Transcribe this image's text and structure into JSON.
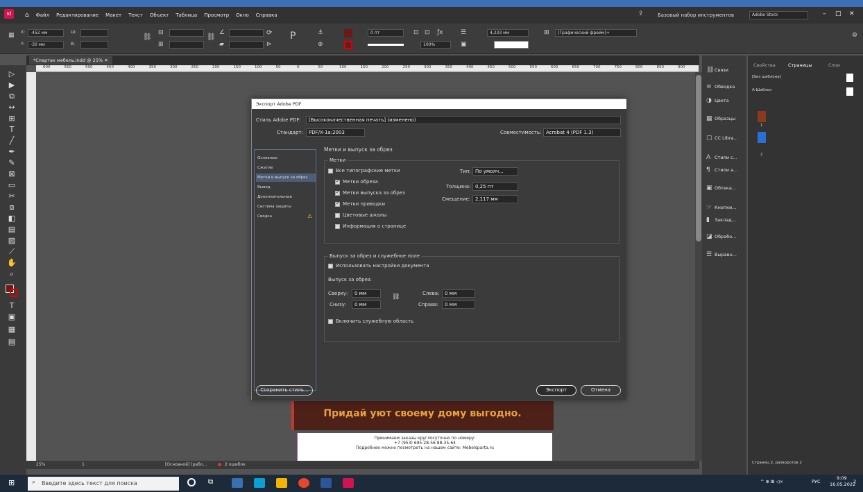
{
  "menubar": {
    "items": [
      "Файл",
      "Редактирование",
      "Макет",
      "Текст",
      "Объект",
      "Таблица",
      "Просмотр",
      "Окно",
      "Справка"
    ],
    "workspace": "Базовый набор инструментов",
    "search_placeholder": "Adobe Stock"
  },
  "controlbar": {
    "x": "-452 мм",
    "y": "-30 мм",
    "w_label": "Ш:",
    "h_label": "В:",
    "stroke": "0 пт",
    "size": "4,233 мм",
    "opacity": "100%",
    "frame_style": "[Графический фрейм]+"
  },
  "document": {
    "tab": "*Спартак мебель.indd @ 25%",
    "zoom": "25%",
    "page": "1",
    "style": "[Основной] (рабо...",
    "errors": "2 ошибок"
  },
  "ruler": [
    "600",
    "550",
    "500",
    "450",
    "400",
    "350",
    "300",
    "250",
    "200",
    "150",
    "100",
    "50",
    "0",
    "50",
    "100",
    "150",
    "200",
    "250",
    "300",
    "350",
    "400",
    "450",
    "500",
    "550",
    "600",
    "650",
    "700",
    "750",
    "800",
    "850",
    "900"
  ],
  "panels": {
    "icons": [
      "Связи",
      "Обводка",
      "Цвета",
      "Образцы",
      "CC Libra...",
      "Стили с...",
      "Стили а...",
      "Обтека...",
      "Кнопки...",
      "Заклад...",
      "Обрабо...",
      "Выравн..."
    ],
    "tabs": [
      "Свойства",
      "Страницы",
      "Слои"
    ],
    "master_none": "[Без шаблона]",
    "master_a": "A-Шаблон",
    "footer": "Страниц 2, разворотов 2",
    "page_nums": [
      "1",
      "2"
    ]
  },
  "dialog": {
    "title": "Экспорт Adobe PDF",
    "style_label": "Стиль Adobe PDF:",
    "style_value": "[Высококачественная печать] (изменено)",
    "standard_label": "Стандарт:",
    "standard_value": "PDF/X-1a:2003",
    "compat_label": "Совместимость:",
    "compat_value": "Acrobat 4 (PDF 1.3)",
    "nav": [
      "Основные",
      "Сжатие",
      "Метки и выпуск за обрез",
      "Вывод",
      "Дополнительные",
      "Система защиты",
      "Сводка"
    ],
    "section_title": "Метки и выпуск за обрез",
    "marks_group": "Метки",
    "all_marks": "Все типографские метки",
    "crop": "Метки обреза",
    "bleed_marks": "Метки выпуска за обрез",
    "reg": "Метки приводки",
    "color_bars": "Цветовые шкалы",
    "page_info": "Информация о странице",
    "type_label": "Тип:",
    "type_value": "По умолч...",
    "weight_label": "Толщина:",
    "weight_value": "0,25 пт",
    "offset_label": "Смещение:",
    "offset_value": "2,117 мм",
    "bleed_group": "Выпуск за обрез и служебное поле",
    "use_doc": "Использовать настройки документа",
    "bleed_label": "Выпуск за обрез:",
    "top_label": "Сверху:",
    "top_value": "0 мм",
    "bottom_label": "Снизу:",
    "bottom_value": "0 мм",
    "left_label": "Слева:",
    "left_value": "0 мм",
    "right_label": "Справа:",
    "right_value": "0 мм",
    "slug": "Включить служебную область",
    "save_style": "Сохранить стиль...",
    "export": "Экспорт",
    "cancel": "Отмена"
  },
  "canvas": {
    "banner": "Придай уют своему дому выгодно.",
    "line1": "Принимаем заказы круглосуточно по номеру:",
    "line2": "+7 (953) 695-28-56 88-35-64",
    "line3": "Подробнее можно посмотреть на нашем сайте: Mebelsparta.ru"
  },
  "taskbar": {
    "search": "Введите здесь текст для поиска",
    "lang": "РУС",
    "time": "9:09",
    "date": "16.05.2022",
    "notif": "2"
  }
}
